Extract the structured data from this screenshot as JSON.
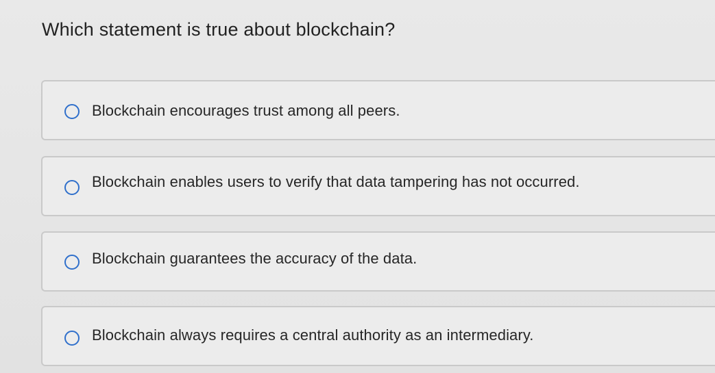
{
  "question": {
    "text": "Which statement is true about blockchain?"
  },
  "options": [
    {
      "label": "Blockchain encourages trust among all peers.",
      "selected": false
    },
    {
      "label": "Blockchain enables users to verify that data tampering has not occurred.",
      "selected": false
    },
    {
      "label": "Blockchain guarantees the accuracy of the data.",
      "selected": false
    },
    {
      "label": "Blockchain always requires a central authority as an intermediary.",
      "selected": false
    }
  ],
  "colors": {
    "background": "#e6e6e6",
    "option_background": "#ececec",
    "option_border": "#c9c9c9",
    "radio_accent": "#2f6fcb",
    "text": "#222222"
  },
  "icons": {
    "radio": "radio-unchecked-icon"
  }
}
